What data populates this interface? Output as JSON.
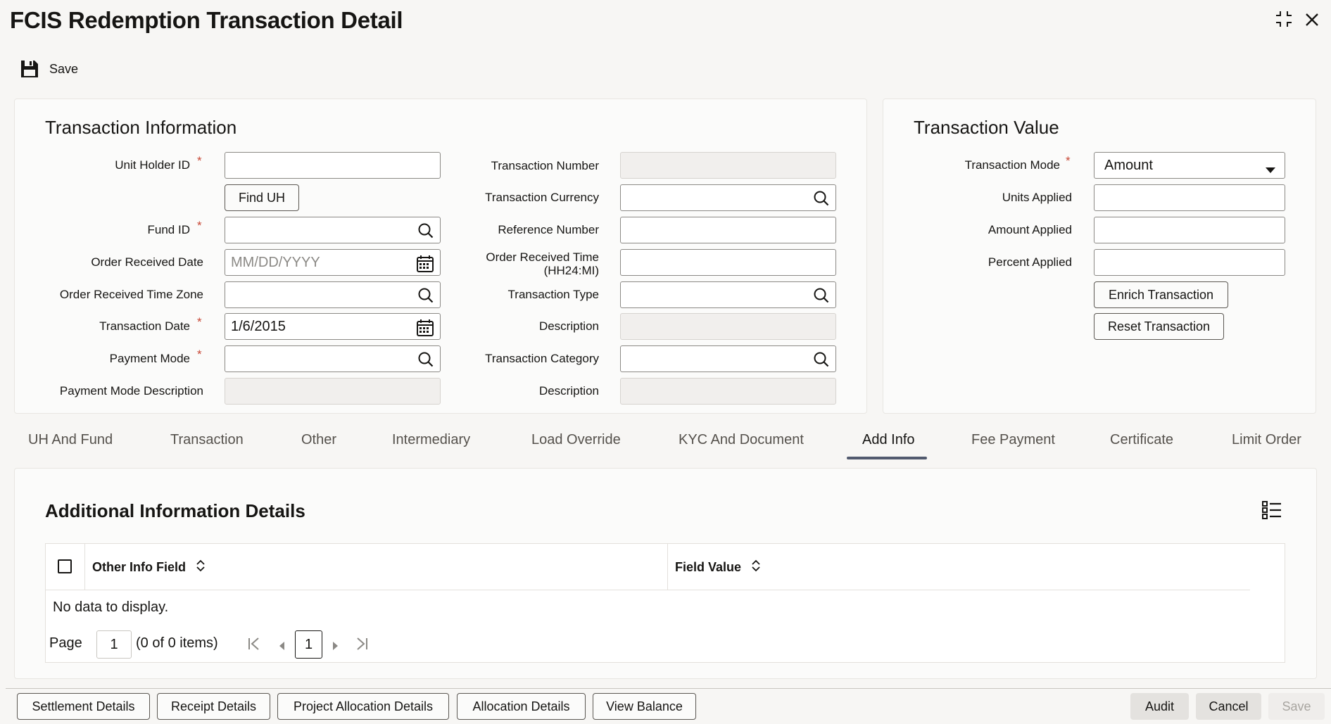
{
  "title": "FCIS Redemption Transaction Detail",
  "toolbar": {
    "save_label": "Save"
  },
  "transaction_information": {
    "heading": "Transaction Information",
    "unit_holder_id_label": "Unit Holder ID",
    "find_uh_label": "Find UH",
    "fund_id_label": "Fund ID",
    "order_received_date_label": "Order Received Date",
    "order_received_date_placeholder": "MM/DD/YYYY",
    "order_received_time_zone_label": "Order Received Time Zone",
    "transaction_date_label": "Transaction Date",
    "transaction_date_value": "1/6/2015",
    "payment_mode_label": "Payment Mode",
    "payment_mode_description_label": "Payment Mode Description",
    "transaction_number_label": "Transaction Number",
    "transaction_currency_label": "Transaction Currency",
    "reference_number_label": "Reference Number",
    "order_received_time_label_1": "Order Received Time",
    "order_received_time_label_2": "(HH24:MI)",
    "transaction_type_label": "Transaction Type",
    "description_label": "Description",
    "transaction_category_label": "Transaction Category",
    "description2_label": "Description",
    "required_mark": "*"
  },
  "transaction_value": {
    "heading": "Transaction Value",
    "transaction_mode_label": "Transaction Mode",
    "transaction_mode_value": "Amount",
    "units_applied_label": "Units Applied",
    "amount_applied_label": "Amount Applied",
    "percent_applied_label": "Percent Applied",
    "enrich_label": "Enrich Transaction",
    "reset_label": "Reset Transaction"
  },
  "tabs": [
    {
      "label": "UH And Fund"
    },
    {
      "label": "Transaction"
    },
    {
      "label": "Other"
    },
    {
      "label": "Intermediary"
    },
    {
      "label": "Load Override"
    },
    {
      "label": "KYC And Document"
    },
    {
      "label": "Add Info"
    },
    {
      "label": "Fee Payment"
    },
    {
      "label": "Certificate"
    },
    {
      "label": "Limit Order"
    }
  ],
  "active_tab": "Add Info",
  "additional_info": {
    "heading": "Additional Information Details",
    "col_other_info_field": "Other Info Field",
    "col_field_value": "Field Value",
    "empty_text": "No data to display.",
    "page_label": "Page",
    "page_input": "1",
    "items_text": "(0 of 0 items)",
    "current_page": "1"
  },
  "footer": {
    "settlement": "Settlement Details",
    "receipt": "Receipt Details",
    "project_allocation": "Project Allocation Details",
    "allocation": "Allocation Details",
    "view_balance": "View Balance",
    "audit": "Audit",
    "cancel": "Cancel",
    "save": "Save"
  },
  "icons": {
    "save": "floppy-disk-icon",
    "search": "magnifier-icon",
    "calendar": "calendar-icon",
    "maximize": "maximize-icon",
    "close": "close-icon",
    "sort": "sort-icon",
    "columns": "list-columns-icon"
  },
  "colors": {
    "required": "#c74634",
    "tab_underline": "#525a6e"
  }
}
